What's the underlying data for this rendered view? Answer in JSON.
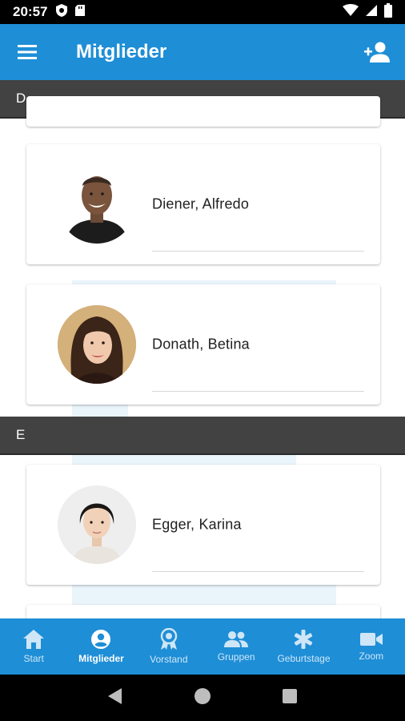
{
  "status_bar": {
    "time": "20:57"
  },
  "app_bar": {
    "title": "Mitglieder"
  },
  "sections": [
    {
      "letter": "D",
      "members": [
        {
          "name": "Diener, Alfredo"
        },
        {
          "name": "Donath, Betina"
        }
      ]
    },
    {
      "letter": "E",
      "members": [
        {
          "name": "Egger, Karina"
        }
      ]
    }
  ],
  "bottom_nav": {
    "items": [
      {
        "label": "Start",
        "icon": "home-icon"
      },
      {
        "label": "Mitglieder",
        "icon": "account-circle-icon",
        "active": true
      },
      {
        "label": "Vorstand",
        "icon": "award-icon"
      },
      {
        "label": "Gruppen",
        "icon": "group-icon"
      },
      {
        "label": "Geburtstage",
        "icon": "asterisk-icon"
      },
      {
        "label": "Zoom",
        "icon": "video-camera-icon"
      }
    ]
  },
  "colors": {
    "primary": "#1e8ed6",
    "section_header": "#424242",
    "inactive_nav": "#cfe6f7"
  }
}
